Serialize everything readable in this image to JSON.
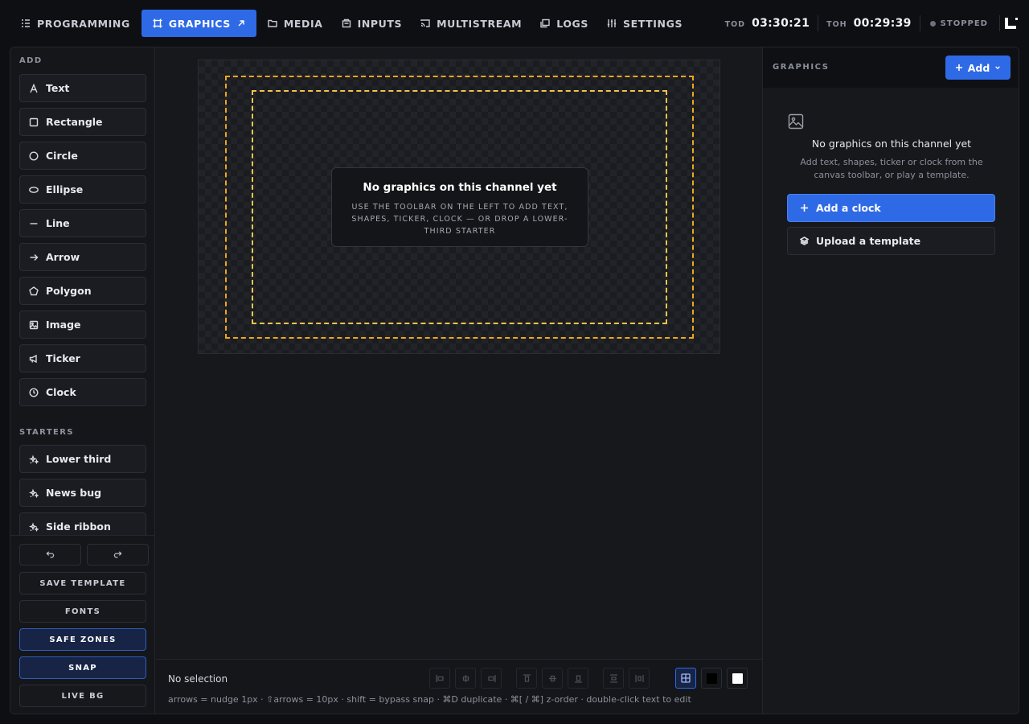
{
  "nav": {
    "tabs": [
      {
        "label": "PROGRAMMING",
        "icon": "list-icon"
      },
      {
        "label": "GRAPHICS",
        "icon": "frame-icon",
        "active": true
      },
      {
        "label": "MEDIA",
        "icon": "folder-icon"
      },
      {
        "label": "INPUTS",
        "icon": "inputs-icon"
      },
      {
        "label": "MULTISTREAM",
        "icon": "cast-icon"
      },
      {
        "label": "LOGS",
        "icon": "logs-icon"
      },
      {
        "label": "SETTINGS",
        "icon": "sliders-icon"
      }
    ]
  },
  "timers": {
    "tod_label": "TOD",
    "tod_value": "03:30:21",
    "toh_label": "TOH",
    "toh_value": "00:29:39",
    "status": "STOPPED"
  },
  "sidebar": {
    "add_title": "ADD",
    "tools": [
      "Text",
      "Rectangle",
      "Circle",
      "Ellipse",
      "Line",
      "Arrow",
      "Polygon",
      "Image",
      "Ticker",
      "Clock"
    ],
    "starters_title": "STARTERS",
    "starters": [
      "Lower third",
      "News bug",
      "Side ribbon"
    ],
    "actions": {
      "save_template": "SAVE TEMPLATE",
      "fonts": "FONTS",
      "safe_zones": "SAFE ZONES",
      "snap": "SNAP",
      "live_bg": "LIVE BG"
    }
  },
  "canvas": {
    "empty_title": "No graphics on this channel yet",
    "empty_sub": "USE THE TOOLBAR ON THE LEFT TO ADD TEXT, SHAPES, TICKER, CLOCK — OR DROP A LOWER-THIRD STARTER",
    "safe_zones_on": true
  },
  "footer": {
    "selection": "No selection",
    "hint": "arrows = nudge 1px · ⇧arrows = 10px · shift = bypass snap · ⌘D duplicate · ⌘[ / ⌘] z-order · double-click text to edit",
    "bg_swatches": [
      "#000000",
      "#ffffff"
    ]
  },
  "panel": {
    "title": "GRAPHICS",
    "add_label": "Add",
    "empty_title": "No graphics on this channel yet",
    "empty_sub": "Add text, shapes, ticker or clock from the canvas toolbar, or play a template.",
    "add_clock": "Add a clock",
    "upload_template": "Upload a template"
  },
  "colors": {
    "accent": "#2f6ae6",
    "safe_zone_outer": "#f0a81c",
    "safe_zone_inner": "#f0c64a"
  }
}
